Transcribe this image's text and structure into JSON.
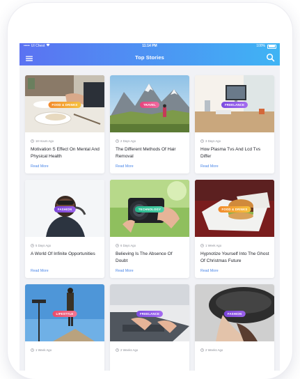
{
  "status": {
    "carrier": "UI Chest",
    "time": "11:14 PM",
    "battery": "100%"
  },
  "header": {
    "title": "Top Stories"
  },
  "colors": {
    "header_start": "#5b72f2",
    "header_end": "#3fb4f4",
    "link": "#4a86e8"
  },
  "icons": {
    "menu": "hamburger-menu-icon",
    "search": "search-icon",
    "time": "clock-icon"
  },
  "cards": [
    {
      "tag": "FOOD & DRINKS",
      "tag_color": "#f28a2d",
      "tag_color2": "#f6c23e",
      "time": "18 Hours Ago",
      "title": "Motivation S Effect On Mental And Physical Health",
      "link": "Read More"
    },
    {
      "tag": "TRAVEL",
      "tag_color": "#e6437c",
      "tag_color2": "#f06aa0",
      "time": "2 Days Ago",
      "title": "The Different Methods Of Hair Removal",
      "link": "Read More"
    },
    {
      "tag": "FREELANCE",
      "tag_color": "#7c4ce0",
      "tag_color2": "#a56cf0",
      "time": "3 Days Ago",
      "title": "How Plasma Tvs And Lcd Tvs Differ",
      "link": "Read More"
    },
    {
      "tag": "FASHION",
      "tag_color": "#7a44d8",
      "tag_color2": "#9a62ea",
      "time": "5 Days Ago",
      "title": "A World Of Infinite Opportunities",
      "link": "Read More"
    },
    {
      "tag": "TECHNOLOGY",
      "tag_color": "#24b58a",
      "tag_color2": "#4fd0a8",
      "time": "6 Days Ago",
      "title": "Believing Is The Absence Of Doubt",
      "link": "Read More"
    },
    {
      "tag": "FOOD & DRINKS",
      "tag_color": "#f28a2d",
      "tag_color2": "#f6c23e",
      "time": "1 Week Ago",
      "title": "Hypnotize Yourself Into The Ghost Of Christmas Future",
      "link": "Read More"
    },
    {
      "tag": "LIFESTYLE",
      "tag_color": "#ec4b6a",
      "tag_color2": "#f27591",
      "time": "1 Week Ago",
      "title": "",
      "link": ""
    },
    {
      "tag": "FREELANCE",
      "tag_color": "#7c4ce0",
      "tag_color2": "#a56cf0",
      "time": "2 Weeks Ago",
      "title": "",
      "link": ""
    },
    {
      "tag": "FASHION",
      "tag_color": "#7a44d8",
      "tag_color2": "#9a62ea",
      "time": "2 Weeks Ago",
      "title": "",
      "link": ""
    }
  ]
}
